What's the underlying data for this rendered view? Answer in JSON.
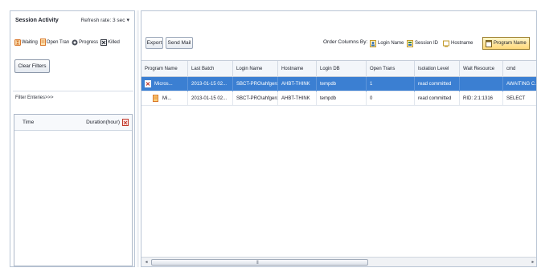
{
  "session_panel": {
    "title": "Session Activity",
    "refresh_label": "Refresh rate: 3 sec",
    "legend": [
      {
        "label": "Waiting",
        "icon": "hourglass-icon",
        "color": "#d9772a"
      },
      {
        "label": "Open Tran",
        "icon": "open-transaction-icon",
        "color": "#d9772a"
      },
      {
        "label": "Progress",
        "icon": "progress-gear-icon",
        "color": "#4a4f5a"
      },
      {
        "label": "Killed",
        "icon": "killed-x-icon",
        "color": "#30343e"
      }
    ],
    "clear_filters_label": "Clear Filters",
    "filter_row_text": "Filter Enteries>>>",
    "grid_columns": [
      "Time",
      "Duration(hour)"
    ]
  },
  "toolbar": {
    "export_label": "Export",
    "send_mail_label": "Send Mail",
    "order_label": "Order Columns By:",
    "order_buttons": [
      {
        "label": "Login Name",
        "icon": "user-icon",
        "active": false
      },
      {
        "label": "Session ID",
        "icon": "session-id-icon",
        "active": false
      },
      {
        "label": "Hostname",
        "icon": "host-icon",
        "active": false
      },
      {
        "label": "Program Name",
        "icon": "program-icon",
        "active": true
      }
    ]
  },
  "grid": {
    "columns": [
      "Program Name",
      "Last Batch",
      "Login Name",
      "Hostname",
      "Login DB",
      "Open Trans",
      "Isolation Level",
      "Wait Resource",
      "cmd"
    ],
    "rows": [
      {
        "selected": true,
        "icon": "killed-x-icon",
        "cells": [
          "Micros...",
          "2013-01-15 02...",
          "SBCT-PRO\\ahfgerd",
          "AHBT-THINK",
          "tempdb",
          "1",
          "read committed",
          "",
          "AWAITING C..."
        ]
      },
      {
        "selected": false,
        "icon": "open-transaction-icon",
        "cells": [
          "Mi...",
          "2013-01-15 02...",
          "SBCT-PRO\\ahfgerd",
          "AHBT-THINK",
          "tempdb",
          "0",
          "read committed",
          "RID: 2:1:1316",
          "SELECT"
        ]
      }
    ]
  },
  "colors": {
    "selection": "#3b7fd2",
    "border": "#b8c4d4",
    "active_order": "#ffd97a"
  }
}
